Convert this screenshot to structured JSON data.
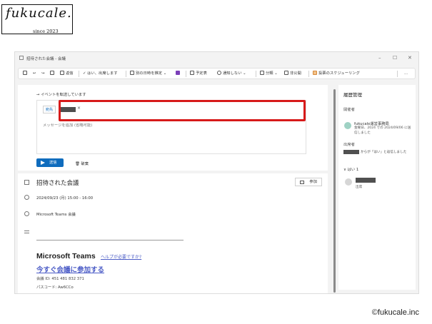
{
  "logo": {
    "wordmark": "fukucale.",
    "since": "since 2023"
  },
  "copyright": "©fukucale.inc",
  "window": {
    "title": "招待された会議 - 会議",
    "controls": {
      "minimize": "–",
      "maximize": "☐",
      "close": "✕"
    }
  },
  "toolbar": {
    "items": [
      "返信",
      "はい、出席します",
      "別の日時を推定",
      "予定表",
      "通知しない",
      "分類",
      "非公開",
      "投票のスケジューリング",
      "..."
    ]
  },
  "reply": {
    "forward_note": "→ イベントを転送しています",
    "to_label": "宛先",
    "chip_remove": "×",
    "message_placeholder": "メッセージを追加 (省略可能)",
    "send_label": "送信",
    "discard_label": "破棄"
  },
  "event": {
    "title": "招待された会議",
    "join_label": "参加",
    "datetime": "2024/09/23 (月) 15:00 - 16:00",
    "location": "Microsoft Teams 会議",
    "teams_heading": "Microsoft Teams",
    "help_link": "ヘルプが必要ですか?",
    "join_link": "今すぐ会議に参加する",
    "meeting_id": "会議 ID: 451 481 832 371",
    "passcode": "パスコード: Aw6CCo"
  },
  "tracking": {
    "title": "履歴管理",
    "organizer_label": "開催者",
    "organizer_name": "fukucale運営事務局",
    "organizer_meta": "金曜日、2024 での 2024/09/06 に送信しました",
    "attendees_label": "出席者",
    "attendees_text": "からが「はい」と返信しました",
    "yes_label": "∨ はい 1",
    "person_status": "出席"
  },
  "colors": {
    "accent": "#0f6cbd",
    "highlight": "#d71a1a",
    "link": "#4a5bc6"
  }
}
